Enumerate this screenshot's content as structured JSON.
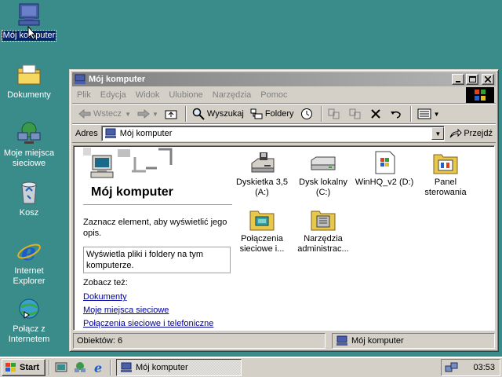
{
  "desktop": {
    "icons": [
      {
        "label": "Mój komputer",
        "icon": "my-computer-icon",
        "selected": true
      },
      {
        "label": "Dokumenty",
        "icon": "documents-folder-icon"
      },
      {
        "label": "Moje miejsca sieciowe",
        "icon": "network-places-icon"
      },
      {
        "label": "Kosz",
        "icon": "recycle-bin-icon"
      },
      {
        "label": "Internet Explorer",
        "icon": "internet-explorer-icon"
      },
      {
        "label": "Połącz z Internetem",
        "icon": "connect-internet-icon"
      }
    ],
    "background_color": "#3a8c8a"
  },
  "window": {
    "title": "Mój komputer",
    "menu": [
      "Plik",
      "Edycja",
      "Widok",
      "Ulubione",
      "Narzędzia",
      "Pomoc"
    ],
    "toolbar": {
      "back_label": "Wstecz",
      "search_label": "Wyszukaj",
      "folders_label": "Foldery"
    },
    "address": {
      "label": "Adres",
      "value": "Mój komputer",
      "go_label": "Przejdź"
    },
    "left_pane": {
      "title": "Mój komputer",
      "hint": "Zaznacz element, aby wyświetlić jego opis.",
      "description": "Wyświetla pliki i foldery na tym komputerze.",
      "see_also": "Zobacz też:",
      "links": [
        "Dokumenty",
        "Moje miejsca sieciowe",
        "Połączenia sieciowe i telefoniczne"
      ]
    },
    "items": [
      {
        "label": "Dyskietka 3,5 (A:)",
        "icon": "floppy-drive-icon"
      },
      {
        "label": "Dysk lokalny (C:)",
        "icon": "hard-drive-icon"
      },
      {
        "label": "WinHQ_v2 (D:)",
        "icon": "cd-drive-icon"
      },
      {
        "label": "Panel sterowania",
        "icon": "control-panel-icon"
      },
      {
        "label": "Połączenia sieciowe i...",
        "icon": "network-connections-icon"
      },
      {
        "label": "Narzędzia administrac...",
        "icon": "admin-tools-icon"
      }
    ],
    "status": {
      "objects": "Obiektów: 6",
      "location": "Mój komputer"
    },
    "title_gradient": [
      "#808080",
      "#b5b5b5"
    ]
  },
  "taskbar": {
    "start_label": "Start",
    "task_label": "Mój komputer",
    "clock": "03:53"
  }
}
